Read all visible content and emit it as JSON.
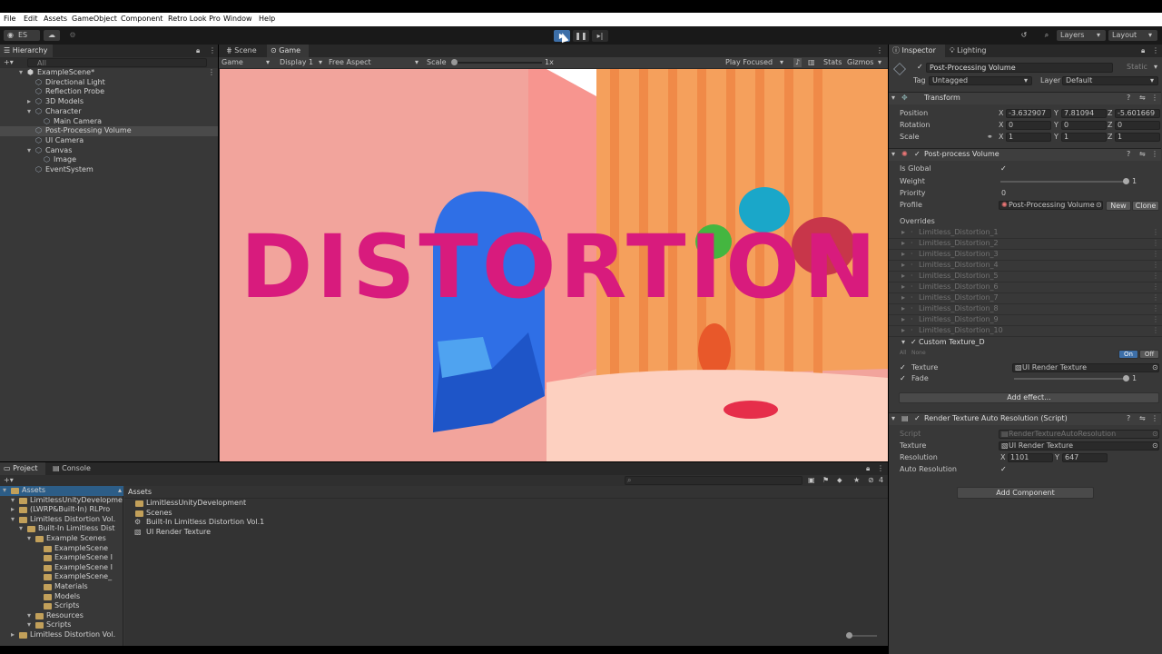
{
  "menu": [
    "File",
    "Edit",
    "Assets",
    "GameObject",
    "Component",
    "Retro Look Pro",
    "Window",
    "Help"
  ],
  "toolbar": {
    "account": "ES",
    "layers": "Layers",
    "layout": "Layout"
  },
  "hierarchy": {
    "tab": "Hierarchy",
    "search_placeholder": "All",
    "items": [
      {
        "label": "ExampleScene*",
        "indent": 0,
        "kind": "scene",
        "selected": false
      },
      {
        "label": "Directional Light",
        "indent": 1,
        "kind": "obj",
        "selected": false
      },
      {
        "label": "Reflection Probe",
        "indent": 1,
        "kind": "obj",
        "selected": false
      },
      {
        "label": "3D Models",
        "indent": 1,
        "kind": "obj",
        "selected": false
      },
      {
        "label": "Character",
        "indent": 1,
        "kind": "obj",
        "selected": false
      },
      {
        "label": "Main Camera",
        "indent": 2,
        "kind": "obj",
        "selected": false
      },
      {
        "label": "Post-Processing Volume",
        "indent": 1,
        "kind": "obj",
        "selected": true
      },
      {
        "label": "UI Camera",
        "indent": 1,
        "kind": "obj",
        "selected": false
      },
      {
        "label": "Canvas",
        "indent": 1,
        "kind": "obj",
        "selected": false
      },
      {
        "label": "Image",
        "indent": 2,
        "kind": "obj",
        "selected": false
      },
      {
        "label": "EventSystem",
        "indent": 1,
        "kind": "obj",
        "selected": false
      }
    ]
  },
  "viewport": {
    "tabs": [
      "Scene",
      "Game"
    ],
    "game_dropdown": "Game",
    "display": "Display 1",
    "aspect": "Free Aspect",
    "scale_label": "Scale",
    "scale_value": "1x",
    "play_mode": "Play Focused",
    "stats": "Stats",
    "gizmos": "Gizmos",
    "overlay_text": "DISTORTION",
    "overlay_color": "#d81b7d"
  },
  "inspector": {
    "tabs": [
      "Inspector",
      "Lighting"
    ],
    "object_name": "Post-Processing Volume",
    "static_label": "Static",
    "tag_label": "Tag",
    "tag": "Untagged",
    "layer_label": "Layer",
    "layer": "Default",
    "transform": {
      "title": "Transform",
      "position_label": "Position",
      "rotation_label": "Rotation",
      "scale_label": "Scale",
      "position": [
        "-3.632907",
        "7.81094",
        "-5.601669"
      ],
      "rotation": [
        "0",
        "0",
        "0"
      ],
      "scale": [
        "1",
        "1",
        "1"
      ],
      "axis": [
        "X",
        "Y",
        "Z"
      ]
    },
    "ppv": {
      "title": "Post-process Volume",
      "is_global_label": "Is Global",
      "weight_label": "Weight",
      "weight": "1",
      "priority_label": "Priority",
      "priority": "0",
      "profile_label": "Profile",
      "profile": "Post-Processing Volume",
      "new_btn": "New",
      "clone_btn": "Clone",
      "overrides_label": "Overrides",
      "overrides": [
        "Limitless_Distortion_1",
        "Limitless_Distortion_2",
        "Limitless_Distortion_3",
        "Limitless_Distortion_4",
        "Limitless_Distortion_5",
        "Limitless_Distortion_6",
        "Limitless_Distortion_7",
        "Limitless_Distortion_8",
        "Limitless_Distortion_9",
        "Limitless_Distortion_10"
      ],
      "custom_texture": "Custom Texture_D",
      "all": "All",
      "none": "None",
      "on": "On",
      "off": "Off",
      "texture_label": "Texture",
      "texture_value": "UI Render Texture",
      "fade_label": "Fade",
      "fade": "1",
      "add_effect": "Add effect..."
    },
    "rtar": {
      "title": "Render Texture Auto Resolution (Script)",
      "script_label": "Script",
      "script": "RenderTextureAutoResolution",
      "texture_label": "Texture",
      "texture": "UI Render Texture",
      "resolution_label": "Resolution",
      "res_x": "1101",
      "res_y": "647",
      "auto_label": "Auto Resolution"
    },
    "add_component": "Add Component"
  },
  "project": {
    "tabs": [
      "Project",
      "Console"
    ],
    "tree": [
      {
        "label": "Assets",
        "indent": 0
      },
      {
        "label": "LimitlessUnityDevelopme",
        "indent": 1
      },
      {
        "label": "(LWRP&Built-In) RLPro",
        "indent": 1
      },
      {
        "label": "Limitless Distortion Vol.",
        "indent": 1
      },
      {
        "label": "Built-In Limitless Dist",
        "indent": 2
      },
      {
        "label": "Example Scenes",
        "indent": 3
      },
      {
        "label": "ExampleScene",
        "indent": 4
      },
      {
        "label": "ExampleScene I",
        "indent": 4
      },
      {
        "label": "ExampleScene I",
        "indent": 4
      },
      {
        "label": "ExampleScene_",
        "indent": 4
      },
      {
        "label": "Materials",
        "indent": 4
      },
      {
        "label": "Models",
        "indent": 4
      },
      {
        "label": "Scripts",
        "indent": 4
      },
      {
        "label": "Resources",
        "indent": 3
      },
      {
        "label": "Scripts",
        "indent": 3
      },
      {
        "label": "Limitless Distortion Vol.",
        "indent": 1
      }
    ],
    "breadcrumb": "Assets",
    "files": [
      {
        "label": "LimitlessUnityDevelopment",
        "kind": "folder"
      },
      {
        "label": "Scenes",
        "kind": "folder"
      },
      {
        "label": "Built-In Limitless Distortion Vol.1",
        "kind": "asset"
      },
      {
        "label": "UI Render Texture",
        "kind": "texture"
      }
    ],
    "hidden_count": "4"
  }
}
